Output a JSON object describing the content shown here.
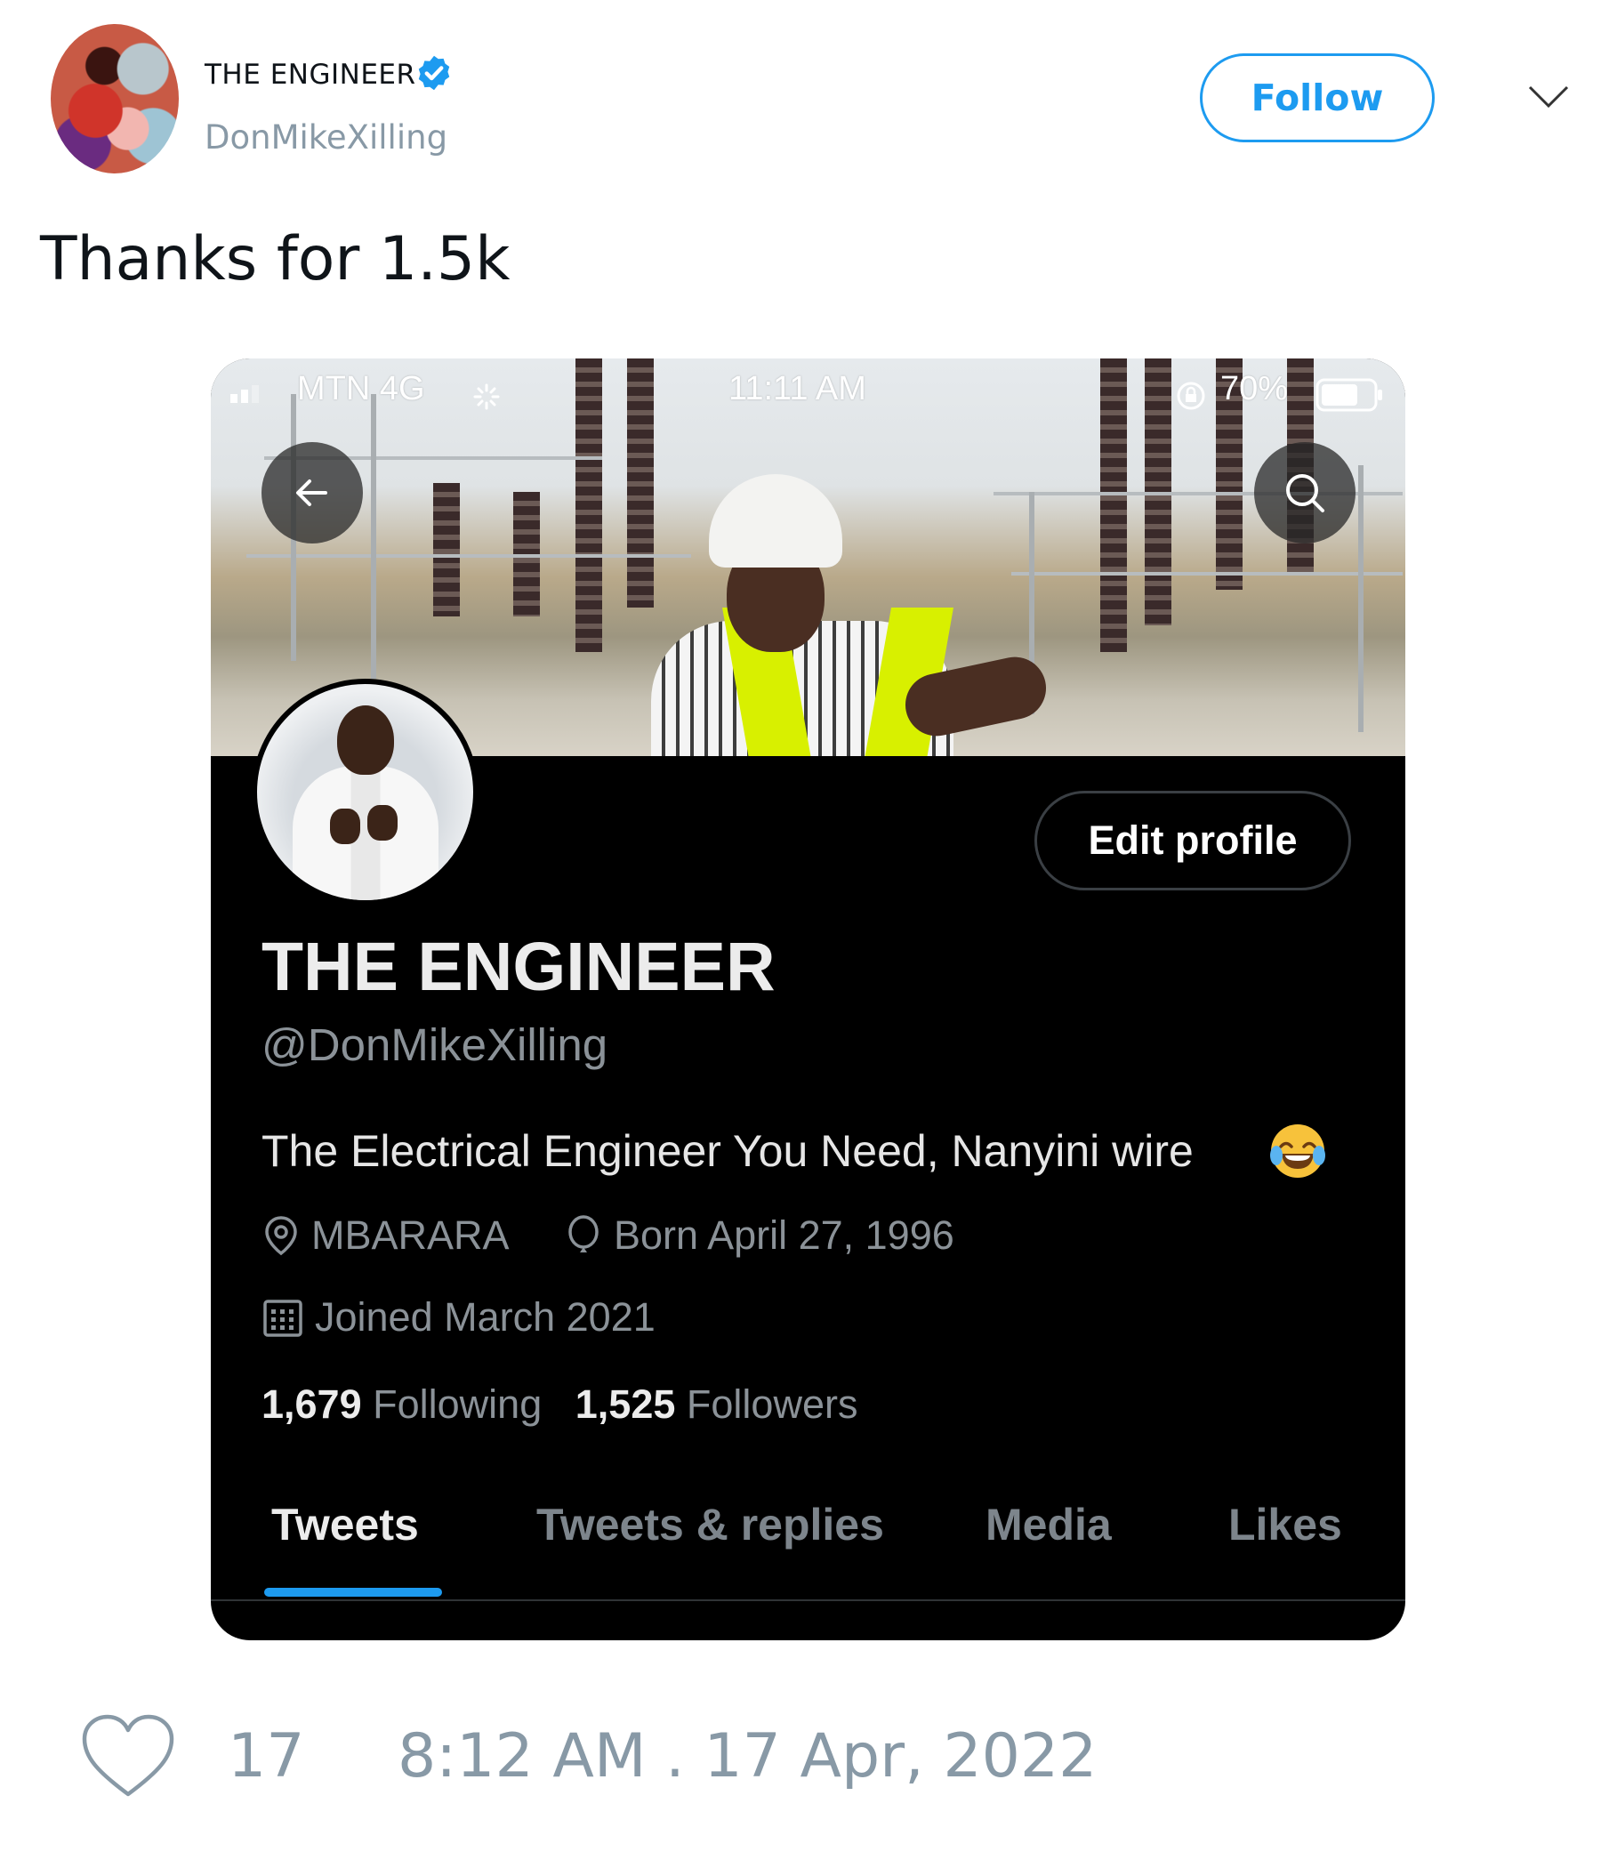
{
  "tweet": {
    "author_name": "THE ENGINEER",
    "author_handle": "DonMikeXilling",
    "follow_label": "Follow",
    "text": "Thanks for 1.5k",
    "like_count": "17",
    "timestamp": "8:12 AM . 17 Apr, 2022"
  },
  "phone": {
    "status_bar": {
      "carrier": "MTN  4G",
      "time": "11:11 AM",
      "battery": "70%"
    },
    "profile": {
      "edit_profile_label": "Edit profile",
      "name": "THE ENGINEER",
      "handle": "@DonMikeXilling",
      "bio": "The Electrical Engineer You Need, Nanyini wire",
      "location": "MBARARA",
      "birthday": "Born April 27, 1996",
      "joined": "Joined March 2021",
      "following_count": "1,679",
      "following_label": "Following",
      "followers_count": "1,525",
      "followers_label": "Followers"
    },
    "tabs": [
      {
        "label": "Tweets",
        "active": true
      },
      {
        "label": "Tweets & replies",
        "active": false
      },
      {
        "label": "Media",
        "active": false
      },
      {
        "label": "Likes",
        "active": false
      }
    ]
  },
  "colors": {
    "accent": "#1d9bf0",
    "muted_text": "#8899a6",
    "dark_background": "#000000"
  },
  "icons": [
    "verified-badge-icon",
    "chevron-down-icon",
    "signal-icon",
    "loading-icon",
    "lock-rotation-icon",
    "battery-icon",
    "back-arrow-icon",
    "search-icon",
    "laughing-emoji-icon",
    "location-pin-icon",
    "balloon-icon",
    "calendar-icon",
    "heart-icon"
  ]
}
